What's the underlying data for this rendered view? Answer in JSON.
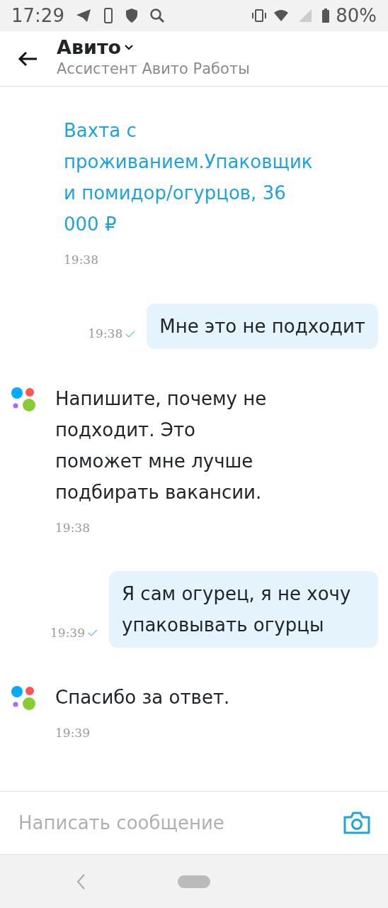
{
  "status_bar": {
    "time": "17:29",
    "battery": "80%"
  },
  "header": {
    "title": "Авито",
    "subtitle": "Ассистент Авито Работы"
  },
  "messages": [
    {
      "kind": "link",
      "text": "Вахта с проживанием.Упаковщики помидор/огурцов, 36 000 ₽",
      "time": "19:38"
    },
    {
      "kind": "outgoing",
      "text": "Мне это не подходит",
      "time": "19:38"
    },
    {
      "kind": "incoming",
      "text": "Напишите, почему не подходит. Это поможет мне лучше подбирать вакансии.",
      "time": "19:38"
    },
    {
      "kind": "outgoing",
      "text": "Я сам огурец, я не хочу упаковывать огурцы",
      "time": "19:39"
    },
    {
      "kind": "incoming",
      "text": "Спасибо за ответ.",
      "time": "19:39"
    }
  ],
  "composer": {
    "placeholder": "Написать сообщение"
  }
}
